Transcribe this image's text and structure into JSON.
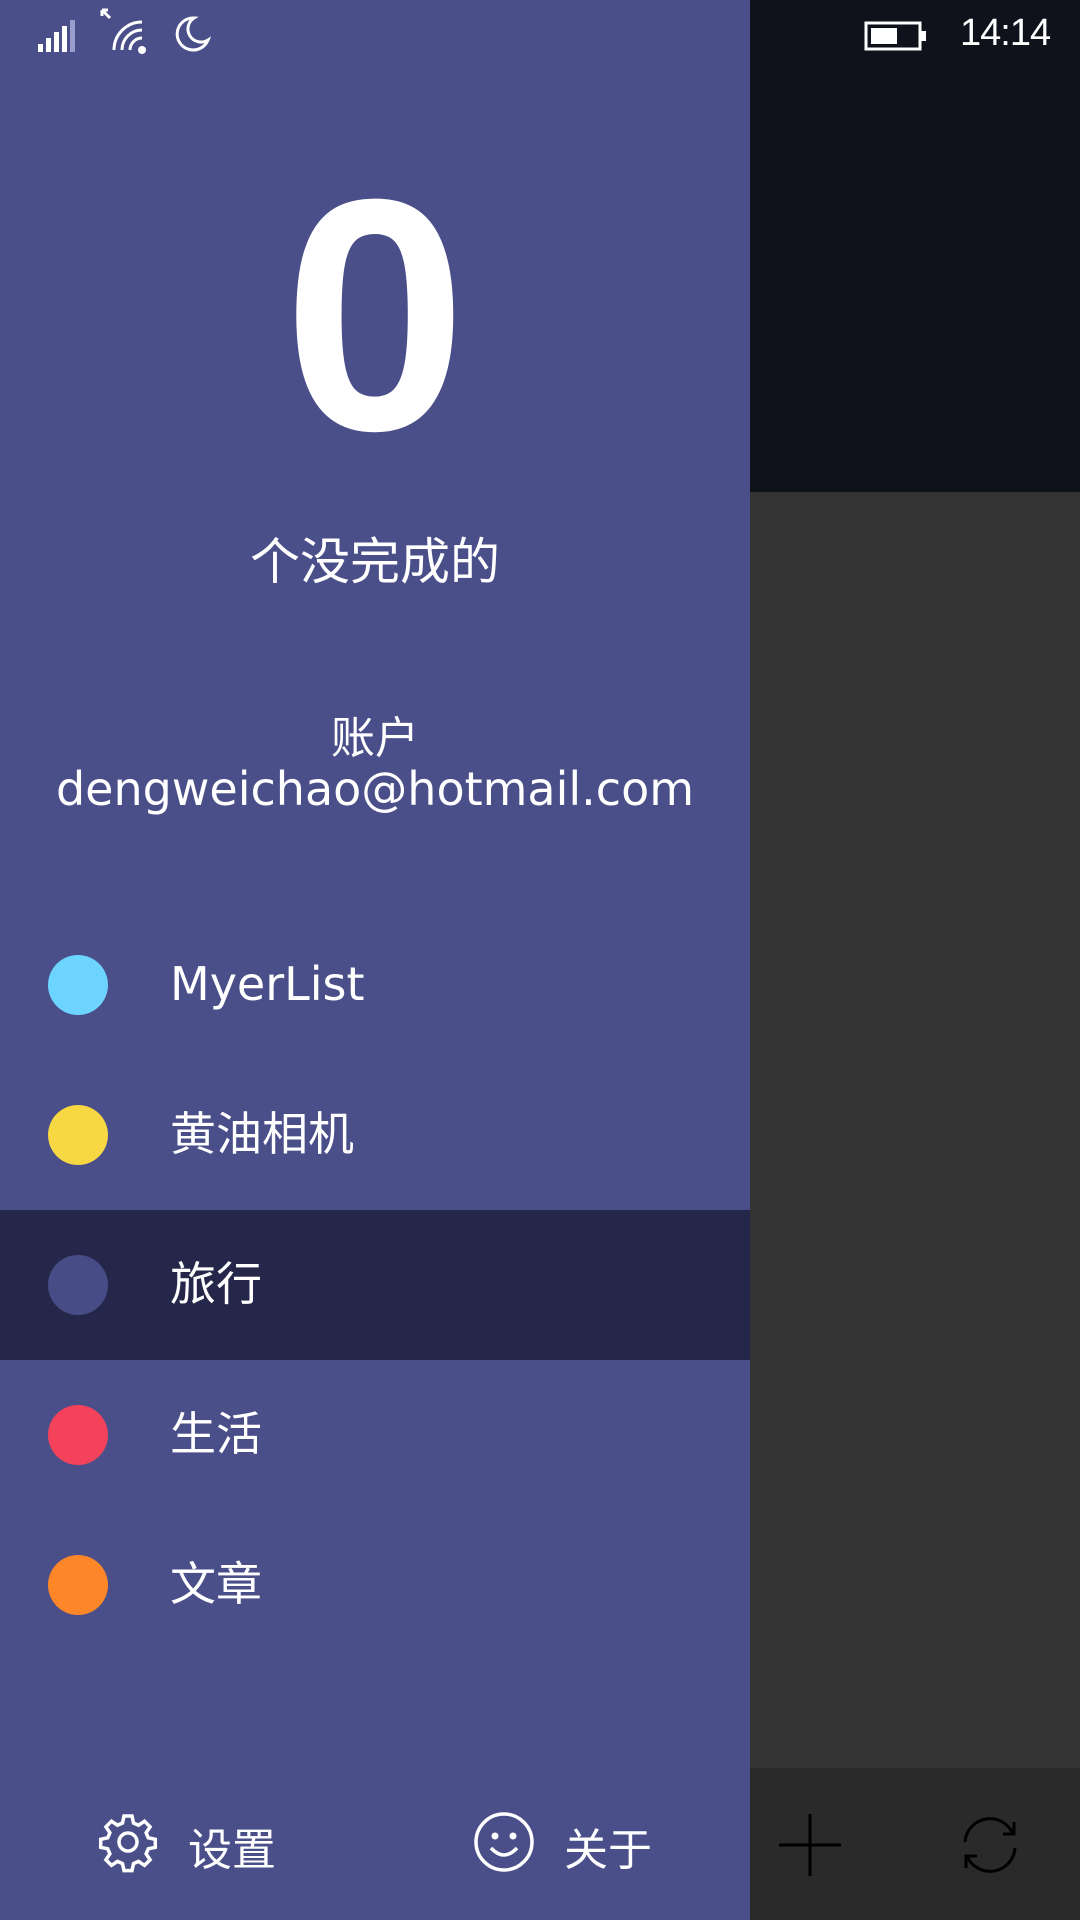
{
  "status_bar": {
    "time": "14:14",
    "icons": [
      "signal-icon",
      "wifi-icon",
      "moon-icon",
      "battery-icon"
    ]
  },
  "drawer": {
    "count": "0",
    "count_label": "个没完成的",
    "account_label": "账户",
    "account_email": "dengweichao@hotmail.com",
    "lists": [
      {
        "label": "MyerList",
        "color": "#6dd3ff",
        "selected": false
      },
      {
        "label": "黄油相机",
        "color": "#f7d842",
        "selected": false
      },
      {
        "label": "旅行",
        "color": "#474c86",
        "selected": true
      },
      {
        "label": "生活",
        "color": "#f4425a",
        "selected": false
      },
      {
        "label": "文章",
        "color": "#fd8629",
        "selected": false
      }
    ],
    "settings_label": "设置",
    "about_label": "关于"
  },
  "background_app": {
    "paren_glyph": ")",
    "appbar_icons": [
      "add-icon",
      "sync-icon"
    ]
  },
  "colors": {
    "drawer_bg": "#4a4f89",
    "selected_bg": "#25274a",
    "bg_topbar": "#0f111b",
    "bg_content": "#333333"
  }
}
